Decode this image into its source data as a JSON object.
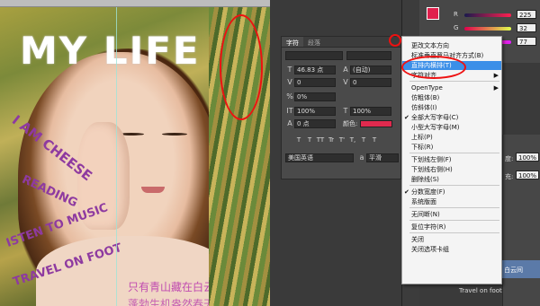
{
  "canvas": {
    "title": "MY LIFE",
    "arc_texts": [
      "I AM CHEESE",
      "READING",
      "ISTEN TO MUSIC",
      "TRAVEL ON FOOT"
    ],
    "poem_line1": "只有青山藏在白云间",
    "poem_line2": "蓬勃生机盎然春天"
  },
  "character_panel": {
    "tabs": [
      "字符",
      "段落"
    ],
    "font_size": "46.83 点",
    "leading": "(自动)",
    "kerning": "0",
    "tracking": "0",
    "scale": "0%",
    "vertical_scale": "100%",
    "horizontal_scale": "100%",
    "baseline_shift": "0 点",
    "color_label": "颜色:",
    "language": "美国英语",
    "antialias": "平滑",
    "style_buttons": [
      "T",
      "T",
      "TT",
      "Tr",
      "T'",
      "T,",
      "T",
      "T"
    ]
  },
  "context_menu": {
    "items": [
      {
        "label": "更改文本方向",
        "checked": false,
        "submenu": false,
        "highlighted": false
      },
      {
        "label": "标准垂直罗马对齐方式(B)",
        "checked": false,
        "submenu": false,
        "highlighted": false
      },
      {
        "label": "直排内横排(T)",
        "checked": false,
        "submenu": false,
        "highlighted": true
      },
      {
        "label": "字符对齐",
        "checked": false,
        "submenu": true,
        "highlighted": false
      },
      {
        "label": "OpenType",
        "checked": false,
        "submenu": true,
        "highlighted": false
      },
      {
        "label": "仿粗体(B)",
        "checked": false,
        "submenu": false,
        "highlighted": false
      },
      {
        "label": "仿斜体(I)",
        "checked": false,
        "submenu": false,
        "highlighted": false
      },
      {
        "label": "全部大写字母(C)",
        "checked": true,
        "submenu": false,
        "highlighted": false
      },
      {
        "label": "小型大写字母(M)",
        "checked": false,
        "submenu": false,
        "highlighted": false
      },
      {
        "label": "上标(P)",
        "checked": false,
        "submenu": false,
        "highlighted": false
      },
      {
        "label": "下标(R)",
        "checked": false,
        "submenu": false,
        "highlighted": false
      },
      {
        "label": "下划线左侧(F)",
        "checked": false,
        "submenu": false,
        "highlighted": false
      },
      {
        "label": "下划线右侧(H)",
        "checked": false,
        "submenu": false,
        "highlighted": false
      },
      {
        "label": "删除线(S)",
        "checked": false,
        "submenu": false,
        "highlighted": false
      },
      {
        "label": "分数宽度(F)",
        "checked": true,
        "submenu": false,
        "highlighted": false
      },
      {
        "label": "系统版面",
        "checked": false,
        "submenu": false,
        "highlighted": false
      },
      {
        "label": "无间断(N)",
        "checked": false,
        "submenu": false,
        "highlighted": false
      },
      {
        "label": "复位字符(R)",
        "checked": false,
        "submenu": false,
        "highlighted": false
      },
      {
        "label": "关闭",
        "checked": false,
        "submenu": false,
        "highlighted": false
      },
      {
        "label": "关闭选项卡组",
        "checked": false,
        "submenu": false,
        "highlighted": false
      }
    ]
  },
  "color_panel": {
    "r_label": "R",
    "g_label": "G",
    "b_label": "B",
    "r_value": "225",
    "g_value": "32",
    "b_value": "77",
    "accent": "#e0204d"
  },
  "layers_panel": {
    "opacity_label": "度:",
    "opacity_value": "100%",
    "fill_label": "充:",
    "fill_value": "100%",
    "layer_text_a": "白云间",
    "layer_name": "Travel on foot"
  }
}
